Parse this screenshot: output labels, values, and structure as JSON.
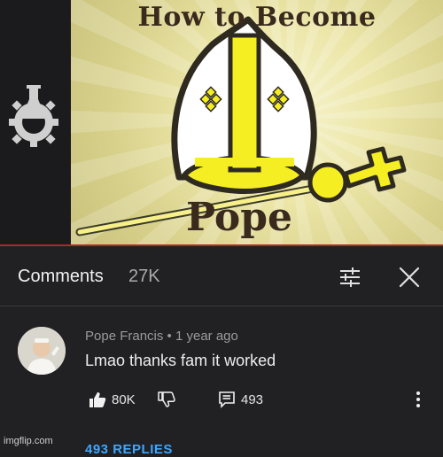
{
  "video": {
    "thumbnail_title": "How to Become",
    "thumbnail_word": "Pope",
    "colors": {
      "accent_line": "#b3262b",
      "mitre_yellow": "#f5ee22"
    },
    "icons": [
      "cgp-gear-flask-icon",
      "mitre-icon",
      "papal-cross-icon"
    ]
  },
  "comments_panel": {
    "title": "Comments",
    "count": "27K",
    "icons": {
      "sort": "sort-sliders-icon",
      "close": "close-icon"
    }
  },
  "comment": {
    "author": "Pope Francis",
    "separator": "•",
    "time": "1 year ago",
    "text": "Lmao thanks fam it worked",
    "likes": "80K",
    "replies": "493",
    "replies_link": "493 REPLIES",
    "icons": {
      "like": "thumbs-up-icon",
      "dislike": "thumbs-down-icon",
      "reply": "reply-icon",
      "more": "more-vertical-icon"
    }
  },
  "watermark": "imgflip.com"
}
